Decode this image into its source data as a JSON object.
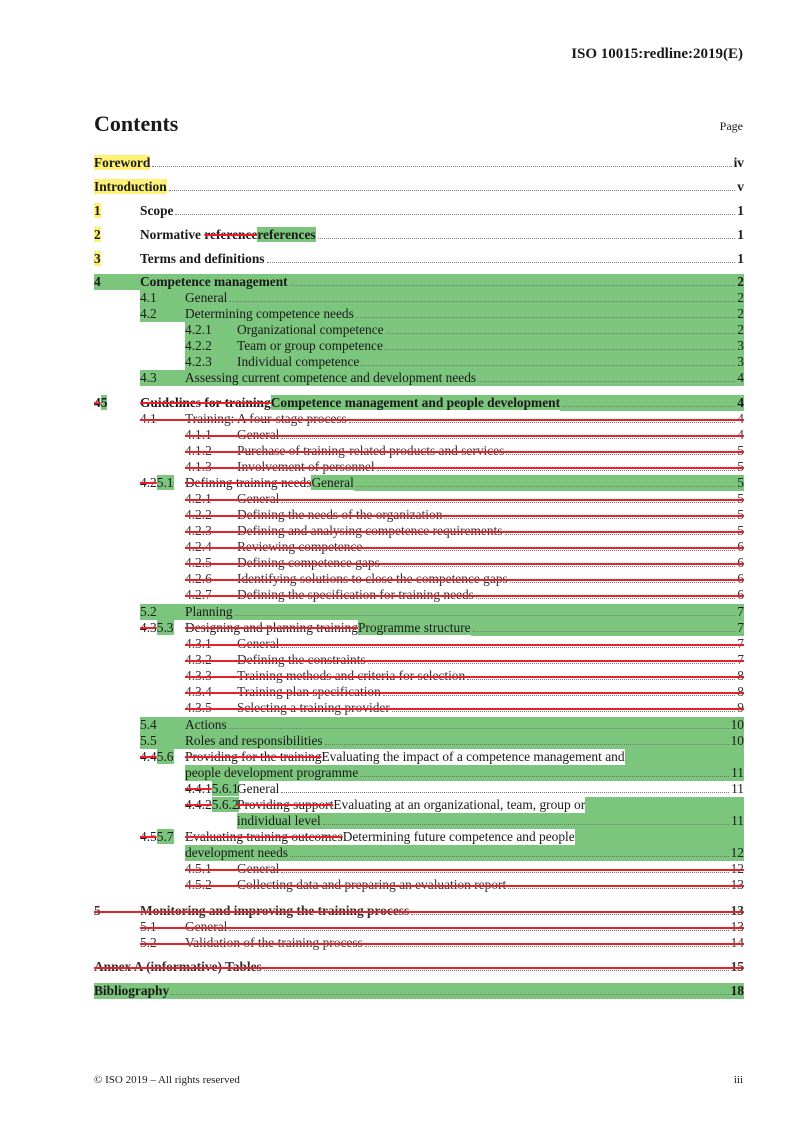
{
  "header": {
    "doc_id": "ISO 10015:redline:2019(E)"
  },
  "title": "Contents",
  "page_label": "Page",
  "highlight_colors": {
    "yellow": "#fff176",
    "green": "#7cc57d",
    "strike": "#e8202a"
  },
  "entries": [
    {
      "id": "foreword",
      "num_old": "",
      "num": "",
      "text_old": "",
      "text": "Foreword",
      "page": "iv",
      "level": 0,
      "bold": true,
      "state": "yellow-label"
    },
    {
      "id": "introduction",
      "num_old": "",
      "num": "",
      "text_old": "",
      "text": "Introduction",
      "page": "v",
      "level": 0,
      "bold": true,
      "state": "yellow-label"
    },
    {
      "id": "scope",
      "num_old": "",
      "num": "1",
      "text_old": "",
      "text": "Scope",
      "page": "1",
      "level": 1,
      "bold": true,
      "state": "yellow-num"
    },
    {
      "id": "normative-references",
      "num_old": "",
      "num": "2",
      "text_old": "reference",
      "text_prefix": "Normative ",
      "text": "references",
      "page": "1",
      "level": 1,
      "bold": true,
      "state": "yellow-num-green-text"
    },
    {
      "id": "terms",
      "num_old": "",
      "num": "3",
      "text_old": "",
      "text": "Terms and definitions",
      "page": "1",
      "level": 1,
      "bold": true,
      "state": "yellow-num"
    },
    {
      "id": "competence-management",
      "num_old": "",
      "num": "4",
      "text_old": "",
      "text": "Competence management",
      "page": "2",
      "level": 1,
      "bold": true,
      "state": "green"
    },
    {
      "id": "4-1",
      "num_old": "",
      "num": "4.1",
      "text_old": "",
      "text": "General",
      "page": "2",
      "level": 2,
      "state": "green"
    },
    {
      "id": "4-2",
      "num_old": "",
      "num": "4.2",
      "text_old": "",
      "text": "Determining competence needs",
      "page": "2",
      "level": 2,
      "state": "green"
    },
    {
      "id": "4-2-1",
      "num_old": "",
      "num": "4.2.1",
      "text_old": "",
      "text": "Organizational competence",
      "page": "2",
      "level": 3,
      "state": "green"
    },
    {
      "id": "4-2-2",
      "num_old": "",
      "num": "4.2.2",
      "text_old": "",
      "text": "Team or group competence",
      "page": "3",
      "level": 3,
      "state": "green"
    },
    {
      "id": "4-2-3",
      "num_old": "",
      "num": "4.2.3",
      "text_old": "",
      "text": "Individual competence",
      "page": "3",
      "level": 3,
      "state": "green"
    },
    {
      "id": "4-3",
      "num_old": "",
      "num": "4.3",
      "text_old": "",
      "text": "Assessing current competence and development needs",
      "page": "4",
      "level": 2,
      "state": "green"
    },
    {
      "id": "5",
      "num_old": "4",
      "num": "5",
      "text_old": "Guidelines for training",
      "text": "Competence management and people development",
      "page": "4",
      "level": 1,
      "bold": true,
      "state": "changed"
    },
    {
      "id": "old-4-1",
      "num": "4.1",
      "text": "Training: A four-stage process",
      "page": "4",
      "level": 2,
      "state": "deleted"
    },
    {
      "id": "old-4-1-1",
      "num": "4.1.1",
      "text": "General",
      "page": "4",
      "level": 3,
      "state": "deleted"
    },
    {
      "id": "old-4-1-2",
      "num": "4.1.2",
      "text": "Purchase of training-related products and services",
      "page": "5",
      "level": 3,
      "state": "deleted"
    },
    {
      "id": "old-4-1-3",
      "num": "4.1.3",
      "text": "Involvement of personnel",
      "page": "5",
      "level": 3,
      "state": "deleted"
    },
    {
      "id": "5-1",
      "num_old": "4.2",
      "num": "5.1",
      "text_old": "Defining training needs",
      "text": "General",
      "page": "5",
      "level": 2,
      "state": "changed"
    },
    {
      "id": "old-4-2-1",
      "num": "4.2.1",
      "text": "General",
      "page": "5",
      "level": 3,
      "state": "deleted"
    },
    {
      "id": "old-4-2-2",
      "num": "4.2.2",
      "text": "Defining the needs of the organization",
      "page": "5",
      "level": 3,
      "state": "deleted"
    },
    {
      "id": "old-4-2-3",
      "num": "4.2.3",
      "text": "Defining and analysing competence requirements",
      "page": "5",
      "level": 3,
      "state": "deleted"
    },
    {
      "id": "old-4-2-4",
      "num": "4.2.4",
      "text": "Reviewing competence",
      "page": "6",
      "level": 3,
      "state": "deleted"
    },
    {
      "id": "old-4-2-5",
      "num": "4.2.5",
      "text": "Defining competence gaps",
      "page": "6",
      "level": 3,
      "state": "deleted"
    },
    {
      "id": "old-4-2-6",
      "num": "4.2.6",
      "text": "Identifying solutions to close the competence gaps",
      "page": "6",
      "level": 3,
      "state": "deleted"
    },
    {
      "id": "old-4-2-7",
      "num": "4.2.7",
      "text": "Defining the specification for training needs",
      "page": "6",
      "level": 3,
      "state": "deleted"
    },
    {
      "id": "5-2",
      "num_old": "",
      "num": "5.2",
      "text_old": "",
      "text": "Planning",
      "page": "7",
      "level": 2,
      "state": "green"
    },
    {
      "id": "5-3",
      "num_old": "4.3",
      "num": "5.3",
      "text_old": "Designing and planning training",
      "text": "Programme structure",
      "page": "7",
      "level": 2,
      "state": "changed"
    },
    {
      "id": "old-4-3-1",
      "num": "4.3.1",
      "text": "General",
      "page": "7",
      "level": 3,
      "state": "deleted"
    },
    {
      "id": "old-4-3-2",
      "num": "4.3.2",
      "text": "Defining the constraints",
      "page": "7",
      "level": 3,
      "state": "deleted"
    },
    {
      "id": "old-4-3-3",
      "num": "4.3.3",
      "text": "Training methods and criteria for selection",
      "page": "8",
      "level": 3,
      "state": "deleted"
    },
    {
      "id": "old-4-3-4",
      "num": "4.3.4",
      "text": "Training plan specification",
      "page": "8",
      "level": 3,
      "state": "deleted"
    },
    {
      "id": "old-4-3-5",
      "num": "4.3.5",
      "text": "Selecting a training provider",
      "page": "9",
      "level": 3,
      "state": "deleted"
    },
    {
      "id": "5-4",
      "num_old": "",
      "num": "5.4",
      "text_old": "",
      "text": "Actions",
      "page": "10",
      "level": 2,
      "state": "green"
    },
    {
      "id": "5-5",
      "num_old": "",
      "num": "5.5",
      "text_old": "",
      "text": "Roles and responsibilities",
      "page": "10",
      "level": 2,
      "state": "green"
    },
    {
      "id": "5-6",
      "num_old": "4.4",
      "num": "5.6",
      "text_old": "Providing for the training",
      "text": "Evaluating the impact of a competence management and",
      "text_cont": "people development programme",
      "page": "11",
      "level": 2,
      "state": "changed"
    },
    {
      "id": "5-6-1",
      "num_old": "4.4.1",
      "num": "5.6.1",
      "text_old": "",
      "text": "General",
      "page": "11",
      "level": 3,
      "state": "num-only"
    },
    {
      "id": "5-6-2",
      "num_old": "4.4.2",
      "num": "5.6.2",
      "text_old": "Providing support",
      "text": "Evaluating at an organizational, team, group or",
      "text_cont": "individual level",
      "page": "11",
      "level": 3,
      "state": "changed"
    },
    {
      "id": "5-7",
      "num_old": "4.5",
      "num": "5.7",
      "text_old": "Evaluating training outcomes",
      "text": "Determining future competence and people",
      "text_cont": "development needs",
      "page": "12",
      "level": 2,
      "state": "changed"
    },
    {
      "id": "old-4-5-1",
      "num": "4.5.1",
      "text": "General",
      "page": "12",
      "level": 3,
      "state": "deleted"
    },
    {
      "id": "old-4-5-2",
      "num": "4.5.2",
      "text": "Collecting data and preparing an evaluation report",
      "page": "13",
      "level": 3,
      "state": "deleted"
    },
    {
      "id": "old-5",
      "num": "5",
      "text": "Monitoring and improving the training process",
      "page": "13",
      "level": 1,
      "bold": true,
      "state": "deleted"
    },
    {
      "id": "old-5-1",
      "num": "5.1",
      "text": "General",
      "page": "13",
      "level": 2,
      "state": "deleted"
    },
    {
      "id": "old-5-2",
      "num": "5.2",
      "text": "Validation of the training process",
      "page": "14",
      "level": 2,
      "state": "deleted"
    },
    {
      "id": "annex-a",
      "num": "",
      "text": "Annex A (informative) Tables",
      "page": "15",
      "level": 0,
      "bold": true,
      "state": "deleted"
    },
    {
      "id": "bibliography",
      "num": "",
      "text": "Bibliography",
      "page": "18",
      "level": 0,
      "bold": true,
      "state": "green"
    }
  ],
  "footer": {
    "copyright": "© ISO 2019 – All rights reserved",
    "page_number": "iii"
  }
}
